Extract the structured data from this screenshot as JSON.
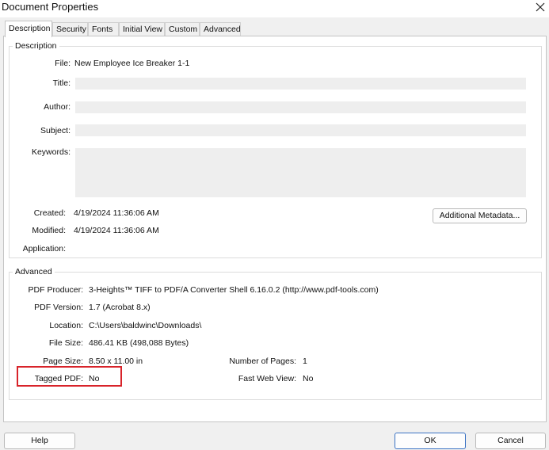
{
  "window": {
    "title": "Document Properties"
  },
  "tabs": [
    {
      "label": "Description",
      "active": true
    },
    {
      "label": "Security"
    },
    {
      "label": "Fonts"
    },
    {
      "label": "Initial View"
    },
    {
      "label": "Custom"
    },
    {
      "label": "Advanced"
    }
  ],
  "description": {
    "group_label": "Description",
    "file_label": "File:",
    "file_value": "New Employee Ice Breaker 1-1",
    "title_label": "Title:",
    "title_value": "",
    "author_label": "Author:",
    "author_value": "",
    "subject_label": "Subject:",
    "subject_value": "",
    "keywords_label": "Keywords:",
    "keywords_value": "",
    "created_label": "Created:",
    "created_value": "4/19/2024 11:36:06 AM",
    "modified_label": "Modified:",
    "modified_value": "4/19/2024 11:36:06 AM",
    "application_label": "Application:",
    "application_value": "",
    "metadata_button": "Additional Metadata..."
  },
  "advanced": {
    "group_label": "Advanced",
    "producer_label": "PDF Producer:",
    "producer_value": "3-Heights™ TIFF to PDF/A Converter Shell 6.16.0.2 (http://www.pdf-tools.com)",
    "version_label": "PDF Version:",
    "version_value": "1.7 (Acrobat 8.x)",
    "location_label": "Location:",
    "location_value": "C:\\Users\\baldwinc\\Downloads\\",
    "filesize_label": "File Size:",
    "filesize_value": "486.41 KB (498,088 Bytes)",
    "pagesize_label": "Page Size:",
    "pagesize_value": "8.50 x 11.00 in",
    "numpages_label": "Number of Pages:",
    "numpages_value": "1",
    "tagged_label": "Tagged PDF:",
    "tagged_value": "No",
    "fastweb_label": "Fast Web View:",
    "fastweb_value": "No"
  },
  "footer": {
    "help": "Help",
    "ok": "OK",
    "cancel": "Cancel"
  },
  "colors": {
    "highlight": "#d8232a",
    "primary_border": "#3b73c4"
  }
}
